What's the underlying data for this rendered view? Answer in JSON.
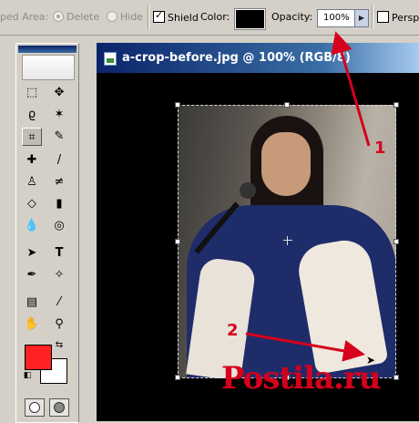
{
  "options_bar": {
    "cropped_area_label": "ped Area:",
    "delete_label": "Delete",
    "hide_label": "Hide",
    "shield_label": "Shield",
    "shield_checked": true,
    "color_label": "Color:",
    "shield_color": "#000000",
    "opacity_label": "Opacity:",
    "opacity_value": "100%",
    "perspective_label": "Perspe"
  },
  "tools_palette": {
    "foreground_color": "#ff2222",
    "background_color": "#ffffff",
    "active_tool": "crop-tool"
  },
  "document": {
    "title": "a-crop-before.jpg @ 100% (RGB/8)"
  },
  "annotations": {
    "marker_1": "1",
    "marker_2": "2",
    "accent_color": "#d6001c"
  },
  "watermark": "Postila.ru"
}
